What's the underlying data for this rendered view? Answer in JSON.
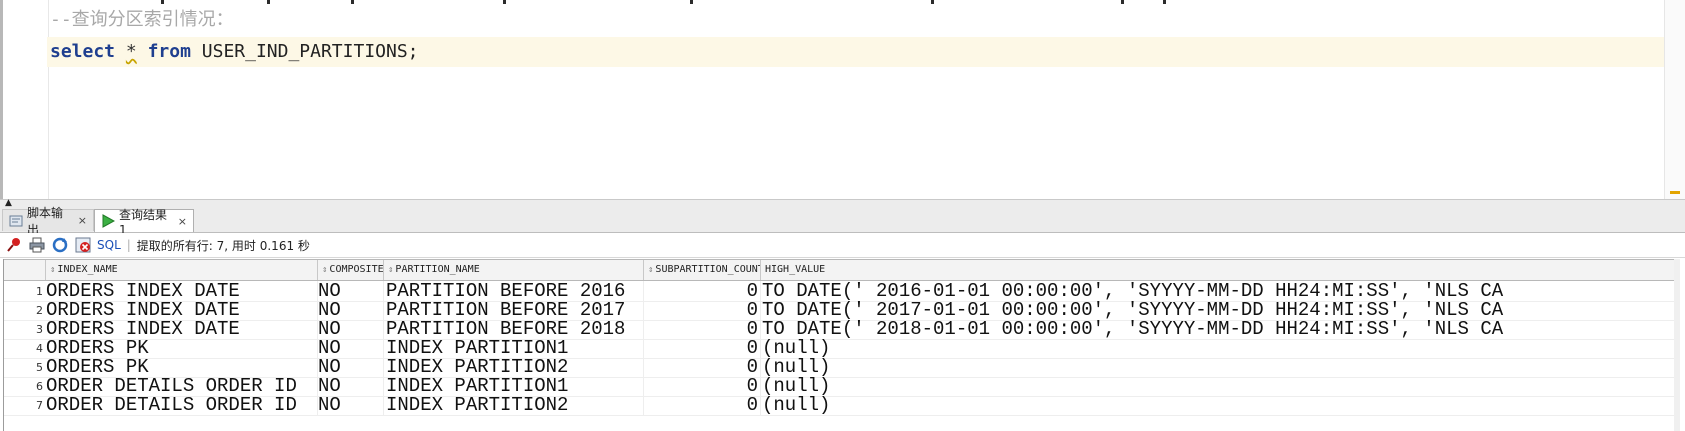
{
  "editor": {
    "comment_line": "--查询分区索引情况：",
    "sql": {
      "kw_select": "select",
      "star": "*",
      "kw_from": "from",
      "table": "USER_IND_PARTITIONS;"
    }
  },
  "tabs": [
    {
      "label": "脚本输出",
      "close": "×",
      "icon": "script-output-icon"
    },
    {
      "label": "查询结果 1",
      "close": "×",
      "icon": "run-green-icon"
    }
  ],
  "toolbar": {
    "sql_link": "SQL",
    "separator": "|",
    "status": "提取的所有行: 7, 用时 0.161 秒"
  },
  "grid": {
    "columns": [
      "INDEX_NAME",
      "COMPOSITE",
      "PARTITION_NAME",
      "SUBPARTITION_COUNT",
      "HIGH_VALUE"
    ],
    "rows": [
      {
        "n": "1",
        "index_name": "ORDERS INDEX DATE",
        "composite": "NO",
        "partition_name": "PARTITION BEFORE 2016",
        "subpartition_count": "0",
        "high_value": "TO DATE(' 2016-01-01 00:00:00', 'SYYYY-MM-DD HH24:MI:SS', 'NLS CA"
      },
      {
        "n": "2",
        "index_name": "ORDERS INDEX DATE",
        "composite": "NO",
        "partition_name": "PARTITION BEFORE 2017",
        "subpartition_count": "0",
        "high_value": "TO DATE(' 2017-01-01 00:00:00', 'SYYYY-MM-DD HH24:MI:SS', 'NLS CA"
      },
      {
        "n": "3",
        "index_name": "ORDERS INDEX DATE",
        "composite": "NO",
        "partition_name": "PARTITION BEFORE 2018",
        "subpartition_count": "0",
        "high_value": "TO DATE(' 2018-01-01 00:00:00', 'SYYYY-MM-DD HH24:MI:SS', 'NLS CA"
      },
      {
        "n": "4",
        "index_name": "ORDERS PK",
        "composite": "NO",
        "partition_name": "INDEX PARTITION1",
        "subpartition_count": "0",
        "high_value": "(null)"
      },
      {
        "n": "5",
        "index_name": "ORDERS PK",
        "composite": "NO",
        "partition_name": "INDEX PARTITION2",
        "subpartition_count": "0",
        "high_value": "(null)"
      },
      {
        "n": "6",
        "index_name": "ORDER DETAILS ORDER ID",
        "composite": "NO",
        "partition_name": "INDEX PARTITION1",
        "subpartition_count": "0",
        "high_value": "(null)"
      },
      {
        "n": "7",
        "index_name": "ORDER DETAILS ORDER ID",
        "composite": "NO",
        "partition_name": "INDEX PARTITION2",
        "subpartition_count": "0",
        "high_value": "(null)"
      }
    ]
  },
  "colors": {
    "keyword": "#1f3f8f",
    "comment": "#a8a8a8",
    "current_line": "#fdf8e6",
    "sql_link": "#1b4fb8"
  }
}
